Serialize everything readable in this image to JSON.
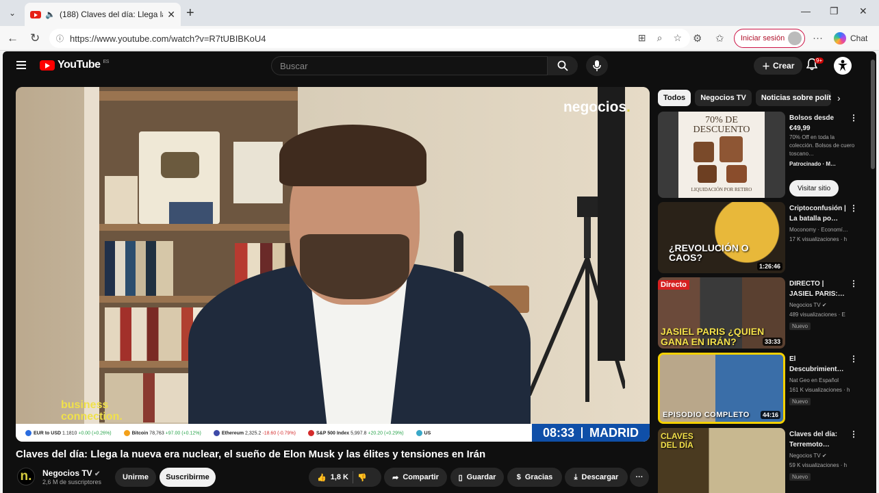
{
  "browser": {
    "tab_title": "(188) Claves del día: Llega la n",
    "url": "https://www.youtube.com/watch?v=R7tUBIBKoU4",
    "signin_label": "Iniciar sesión",
    "chat_label": "Chat"
  },
  "youtube": {
    "logo_text": "YouTube",
    "logo_region": "ES",
    "search_placeholder": "Buscar",
    "create_label": "Crear",
    "notif_badge": "9+"
  },
  "video": {
    "overlay_brand": "negocios",
    "overlay_brand_dot": ".",
    "overlay_corner": "business connection.",
    "ticker": [
      {
        "name": "EUR to USD",
        "value": "1.1810",
        "change": "+0.00 (+0.26%)",
        "dir": "pos",
        "color": "#2a6de0"
      },
      {
        "name": "Bitcoin",
        "value": "78,763",
        "change": "+97.00 (+0.12%)",
        "dir": "pos",
        "color": "#f3a01a"
      },
      {
        "name": "Ethereum",
        "value": "2,325.2",
        "change": "-18.60 (-0.79%)",
        "dir": "neg",
        "color": "#3e4aa8"
      },
      {
        "name": "S&P 500 Index",
        "value": "5,997.8",
        "change": "+20.20 (+0.29%)",
        "dir": "pos",
        "color": "#d42b2b"
      },
      {
        "name": "US",
        "value": "",
        "change": "",
        "dir": "pos",
        "color": "#3aa8c8"
      }
    ],
    "clock_time": "08:33",
    "clock_city": "MADRID",
    "title": "Claves del día: Llega la nueva era nuclear, el sueño de Elon Musk y las élites y tensiones en Irán",
    "channel_name": "Negocios TV",
    "channel_logo": "n.",
    "subscribers": "2,6 M de suscriptores",
    "join_label": "Unirme",
    "subscribe_label": "Suscribirme",
    "likes": "1,8 K",
    "share_label": "Compartir",
    "save_label": "Guardar",
    "thanks_label": "Gracias",
    "download_label": "Descargar"
  },
  "sidebar": {
    "chips": [
      "Todos",
      "Negocios TV",
      "Noticias sobre polític"
    ],
    "ad": {
      "thumb_top": "70% DE DESCUENTO",
      "thumb_bottom": "LIQUIDACIÓN POR RETIRO",
      "title": "Bolsos desde €49,99",
      "desc": "70% Off en toda la colección. Bolsos de cuero toscano…",
      "sponsored": "Patrocinado · M…",
      "visit_label": "Visitar sitio"
    },
    "videos": [
      {
        "title": "Criptoconfusión | La batalla po…",
        "channel": "Moconomy · Economí…",
        "views": "17 K visualizaciones · h",
        "duration": "1:26:46",
        "thumb_text": "¿REVOLUCIÓN O CAOS?",
        "new": ""
      },
      {
        "title": "DIRECTO | JASIEL PARIS:…",
        "channel": "Negocios TV ✔",
        "views": "489 visualizaciones · E",
        "duration": "33:33",
        "thumb_text": "JASIEL PARIS ¿QUIEN GANA EN IRÁN?",
        "thumb_label": "Directo",
        "new": "Nuevo"
      },
      {
        "title": "El Descubrimient…",
        "channel": "Nat Geo en Español",
        "views": "161 K visualizaciones · h",
        "duration": "44:16",
        "thumb_text": "EPISODIO COMPLETO",
        "new": "Nuevo"
      },
      {
        "title": "Claves del día: Terremoto…",
        "channel": "Negocios TV ✔",
        "views": "59 K visualizaciones · h",
        "duration": "",
        "thumb_text": "CLAVES DEL DÍA",
        "new": "Nuevo"
      }
    ]
  }
}
